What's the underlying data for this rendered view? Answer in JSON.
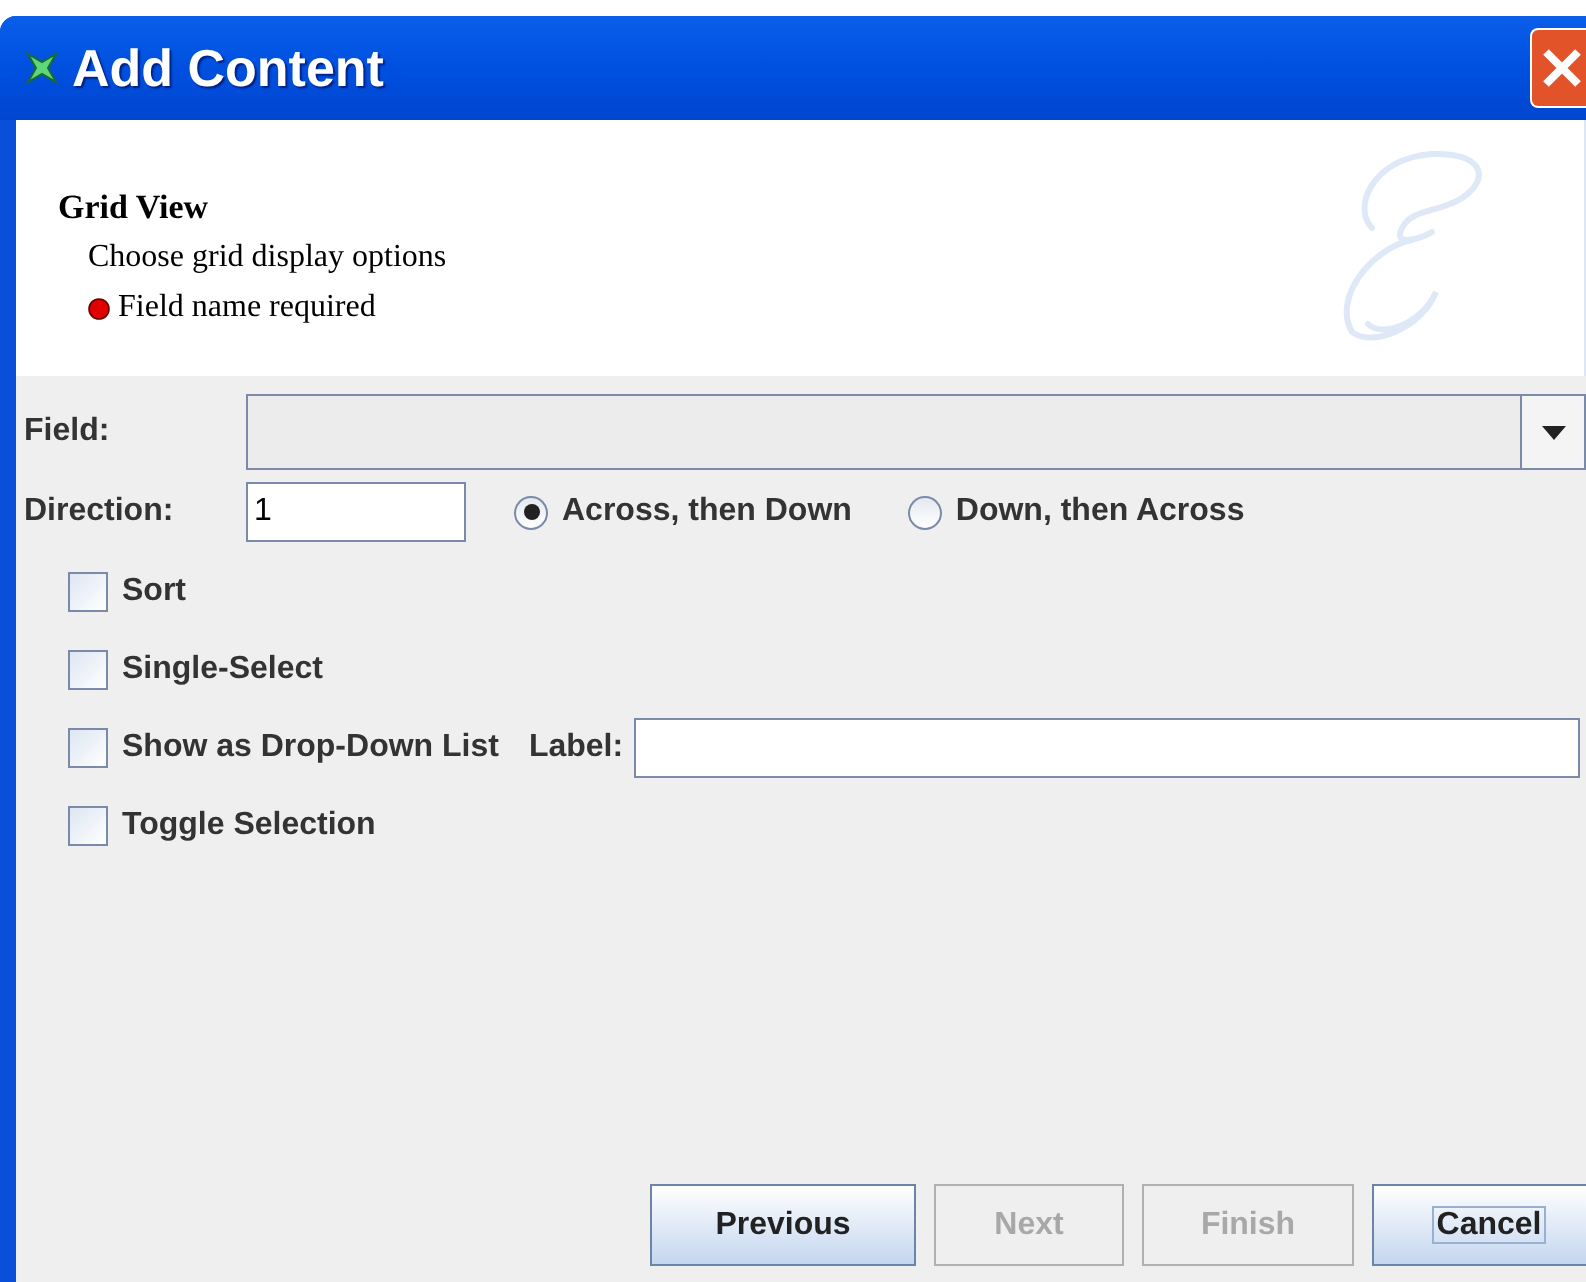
{
  "window": {
    "title": "Add Content"
  },
  "header": {
    "title": "Grid View",
    "subtitle": "Choose grid display options",
    "error": "Field name required"
  },
  "form": {
    "field": {
      "label": "Field:"
    },
    "direction": {
      "label": "Direction:",
      "value": "1"
    },
    "radios": [
      {
        "label": "Across, then Down",
        "selected": true
      },
      {
        "label": "Down, then Across",
        "selected": false
      }
    ],
    "checkboxes": [
      {
        "label": "Sort",
        "checked": false
      },
      {
        "label": "Single-Select",
        "checked": false
      },
      {
        "label": "Show as Drop-Down List",
        "checked": false,
        "extra_label": "Label:"
      },
      {
        "label": "Toggle Selection",
        "checked": false
      }
    ]
  },
  "buttons": [
    {
      "label": "Previous",
      "disabled": false,
      "focused": false
    },
    {
      "label": "Next",
      "disabled": true,
      "focused": false
    },
    {
      "label": "Finish",
      "disabled": true,
      "focused": false
    },
    {
      "label": "Cancel",
      "disabled": false,
      "focused": true
    }
  ]
}
